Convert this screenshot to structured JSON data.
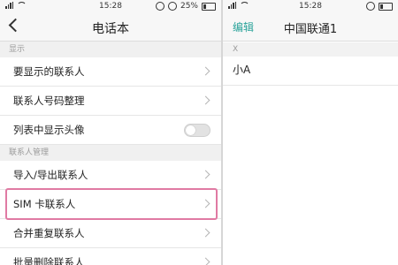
{
  "left": {
    "status": {
      "time": "15:28",
      "battery": "25%"
    },
    "title": "电话本",
    "sections": [
      {
        "header": "显示",
        "rows": [
          {
            "label": "要显示的联系人",
            "control": "chevron"
          },
          {
            "label": "联系人号码整理",
            "control": "chevron"
          },
          {
            "label": "列表中显示头像",
            "control": "toggle",
            "toggle_on": false
          }
        ]
      },
      {
        "header": "联系人管理",
        "rows": [
          {
            "label": "导入/导出联系人",
            "control": "chevron"
          },
          {
            "label": "SIM 卡联系人",
            "control": "chevron",
            "highlighted": true
          },
          {
            "label": "合并重复联系人",
            "control": "chevron"
          },
          {
            "label": "批量删除联系人",
            "control": "chevron"
          }
        ]
      }
    ]
  },
  "right": {
    "status": {
      "time": "15:28"
    },
    "edit_label": "编辑",
    "title": "中国联通1",
    "index_letter": "X",
    "contacts": [
      "小A"
    ]
  },
  "colors": {
    "accent": "#2aa39a",
    "highlight_border": "#e07aa3"
  }
}
